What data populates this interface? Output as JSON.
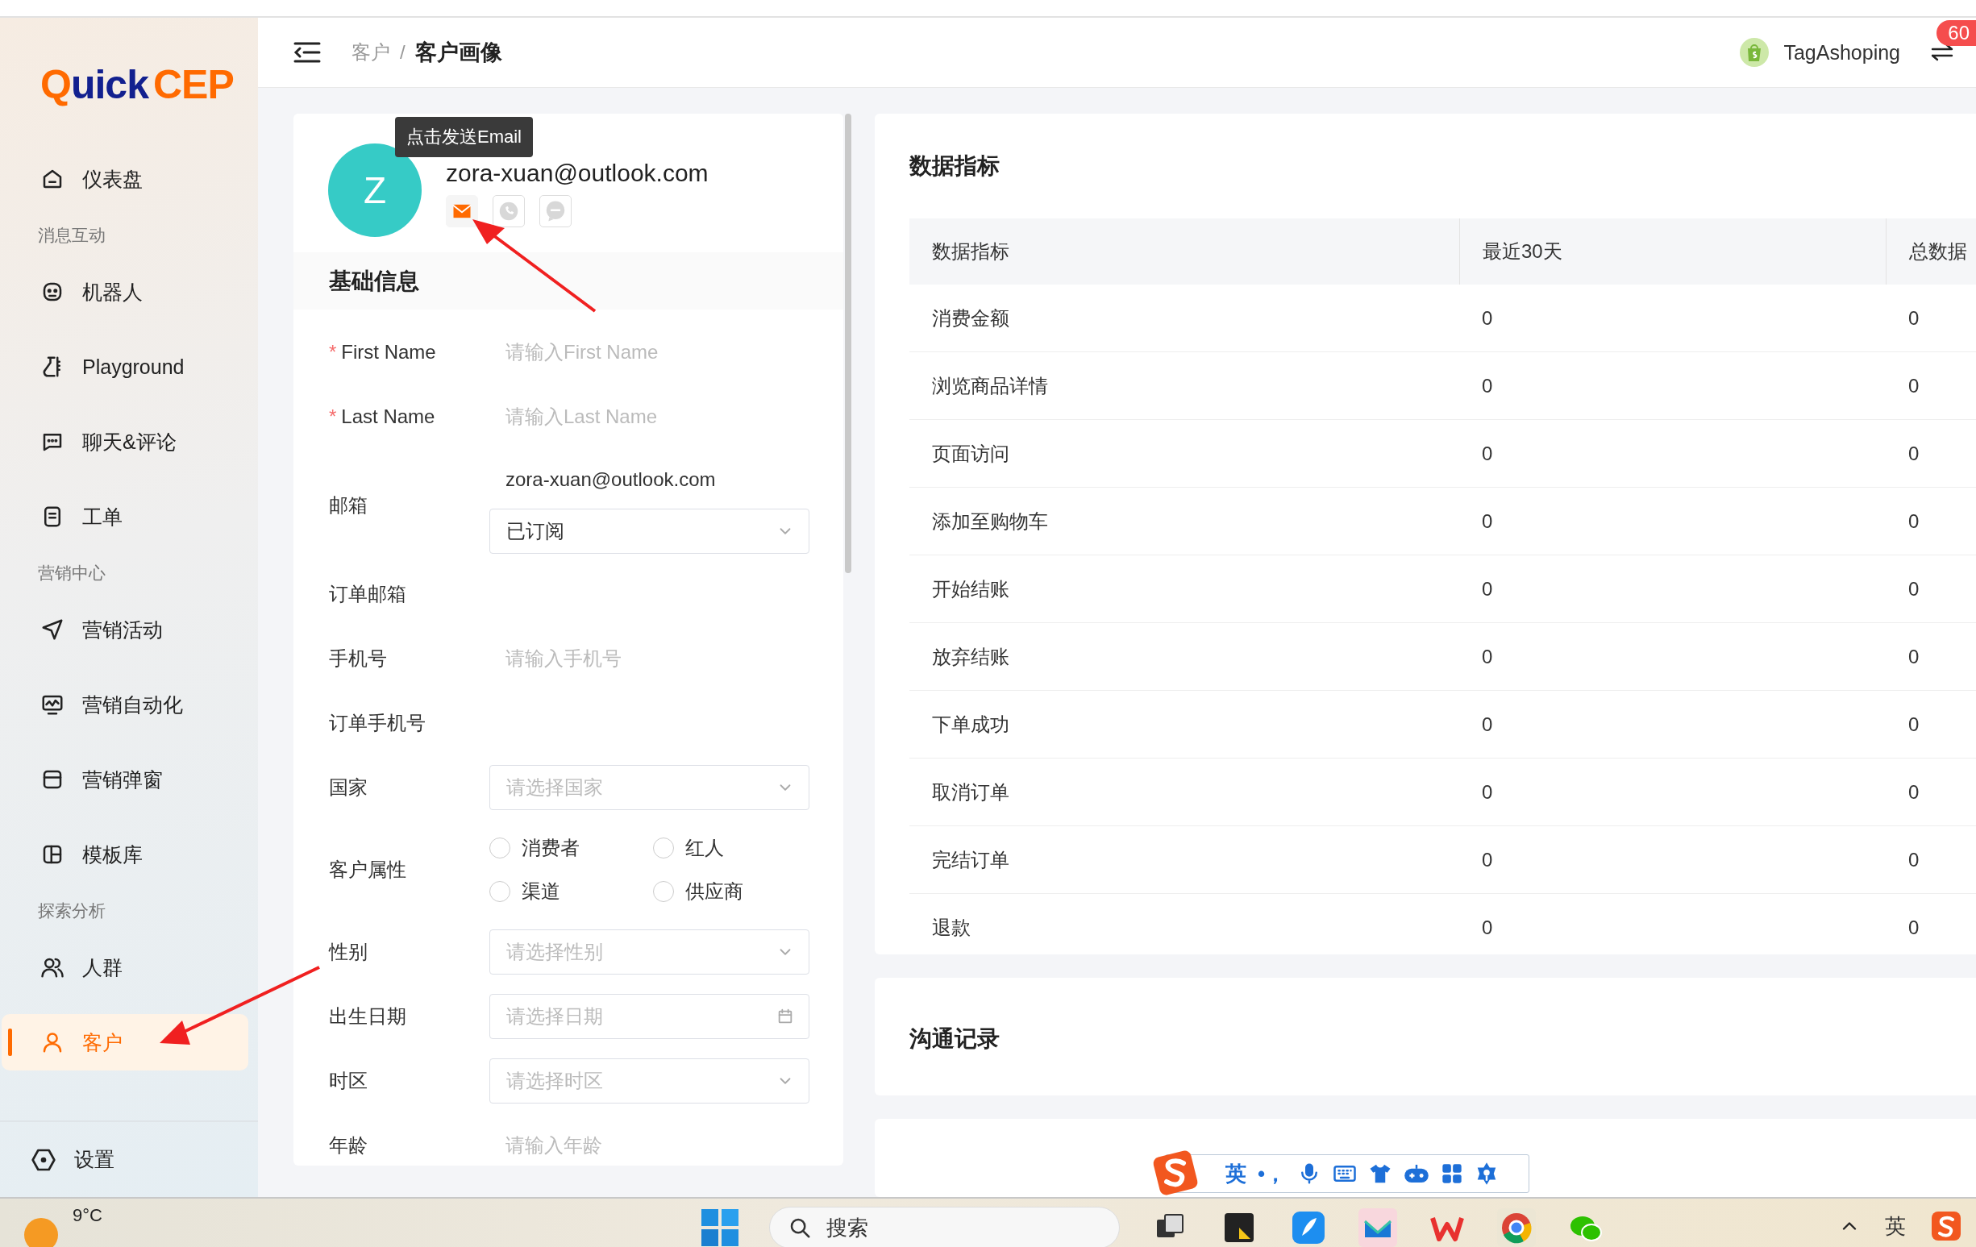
{
  "sidebar": {
    "logo": {
      "mark": "Q",
      "word": "uick",
      "suffix": "CEP"
    },
    "items": [
      {
        "kind": "item",
        "label": "仪表盘",
        "selected": false
      },
      {
        "kind": "group",
        "label": "消息互动"
      },
      {
        "kind": "item",
        "label": "机器人",
        "selected": false
      },
      {
        "kind": "item",
        "label": "Playground",
        "selected": false
      },
      {
        "kind": "item",
        "label": "聊天&评论",
        "selected": false
      },
      {
        "kind": "item",
        "label": "工单",
        "selected": false
      },
      {
        "kind": "group",
        "label": "营销中心"
      },
      {
        "kind": "item",
        "label": "营销活动",
        "selected": false
      },
      {
        "kind": "item",
        "label": "营销自动化",
        "selected": false
      },
      {
        "kind": "item",
        "label": "营销弹窗",
        "selected": false
      },
      {
        "kind": "item",
        "label": "模板库",
        "selected": false
      },
      {
        "kind": "group",
        "label": "探索分析"
      },
      {
        "kind": "item",
        "label": "人群",
        "selected": false
      },
      {
        "kind": "item",
        "label": "客户",
        "selected": true
      }
    ],
    "footer": {
      "label": "设置"
    }
  },
  "header": {
    "breadcrumb": [
      "客户",
      "客户画像"
    ],
    "separator": "/",
    "store": "TagAshoping",
    "badge": "60"
  },
  "profile": {
    "avatar": "Z",
    "email": "zora-xuan@outlook.com",
    "tooltip": "点击发送Email",
    "channels": [
      {
        "active": true
      },
      {
        "active": false
      },
      {
        "active": false
      }
    ],
    "section": "基础信息",
    "fields": [
      {
        "kind": "input",
        "required_mark": "*",
        "label": "First Name",
        "placeholder": "请输入First Name"
      },
      {
        "kind": "input",
        "required_mark": "*",
        "label": "Last Name",
        "placeholder": "请输入Last Name"
      },
      {
        "kind": "email",
        "label": "邮箱",
        "value": "zora-xuan@outlook.com",
        "select": "已订阅"
      },
      {
        "kind": "static",
        "label": "订单邮箱"
      },
      {
        "kind": "input",
        "label": "手机号",
        "placeholder": "请输入手机号"
      },
      {
        "kind": "static",
        "label": "订单手机号"
      },
      {
        "kind": "select",
        "label": "国家",
        "placeholder": "请选择国家"
      },
      {
        "kind": "radio",
        "label": "客户属性",
        "options": [
          {
            "label": "消费者",
            "selected": false
          },
          {
            "label": "红人",
            "selected": false
          },
          {
            "label": "渠道",
            "selected": false
          },
          {
            "label": "供应商",
            "selected": false
          }
        ]
      },
      {
        "kind": "select",
        "label": "性别",
        "placeholder": "请选择性别"
      },
      {
        "kind": "date",
        "label": "出生日期",
        "placeholder": "请选择日期"
      },
      {
        "kind": "select",
        "label": "时区",
        "placeholder": "请选择时区"
      },
      {
        "kind": "input",
        "label": "年龄",
        "placeholder": "请输入年龄"
      }
    ]
  },
  "metrics": {
    "title": "数据指标",
    "columns": [
      "数据指标",
      "最近30天",
      "总数据"
    ],
    "rows": [
      [
        "消费金额",
        "0",
        "0"
      ],
      [
        "浏览商品详情",
        "0",
        "0"
      ],
      [
        "页面访问",
        "0",
        "0"
      ],
      [
        "添加至购物车",
        "0",
        "0"
      ],
      [
        "开始结账",
        "0",
        "0"
      ],
      [
        "放弃结账",
        "0",
        "0"
      ],
      [
        "下单成功",
        "0",
        "0"
      ],
      [
        "取消订单",
        "0",
        "0"
      ],
      [
        "完结订单",
        "0",
        "0"
      ],
      [
        "退款",
        "0",
        "0"
      ]
    ]
  },
  "communications": {
    "title": "沟通记录"
  },
  "ime_bar": {
    "language": "英",
    "punctuation": "•，"
  },
  "taskbar": {
    "temperature": "9°C",
    "search_placeholder": "搜索",
    "language": "英"
  }
}
